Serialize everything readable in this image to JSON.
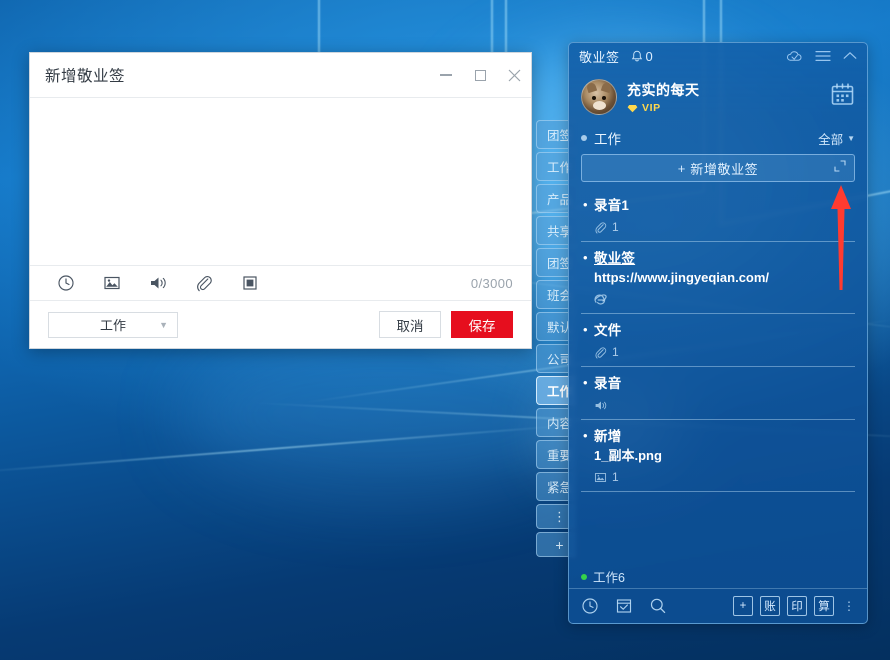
{
  "desktop": {
    "wallpaper_name": "windows-10-hero-wallpaper"
  },
  "dialog": {
    "title": "新增敬业签",
    "window_buttons": {
      "minimize": "minimize-icon",
      "maximize": "maximize-icon",
      "close": "close-icon"
    },
    "editor_placeholder": "",
    "editor_value": "",
    "toolbar": {
      "icons": [
        {
          "name": "reminder-clock-icon",
          "label": "提醒"
        },
        {
          "name": "image-icon",
          "label": "图片"
        },
        {
          "name": "sound-record-icon",
          "label": "录音"
        },
        {
          "name": "attachment-paperclip-icon",
          "label": "附件"
        },
        {
          "name": "screenshot-icon",
          "label": "截图"
        }
      ],
      "char_count": "0/3000"
    },
    "footer": {
      "category_value": "工作",
      "cancel_label": "取消",
      "save_label": "保存"
    }
  },
  "tabstrip": {
    "items": [
      {
        "label": "团签",
        "active": false
      },
      {
        "label": "工作",
        "active": false
      },
      {
        "label": "产品",
        "active": false
      },
      {
        "label": "共享",
        "active": false
      },
      {
        "label": "团签",
        "active": false
      },
      {
        "label": "班会",
        "active": false
      },
      {
        "label": "默认",
        "active": false
      },
      {
        "label": "公司",
        "active": false
      },
      {
        "label": "工作",
        "active": true
      },
      {
        "label": "内容",
        "active": false
      },
      {
        "label": "重要",
        "active": false
      },
      {
        "label": "紧急",
        "active": false
      },
      {
        "label": "⋮",
        "active": false
      },
      {
        "label": "+",
        "active": false
      }
    ]
  },
  "jyq": {
    "header": {
      "brand": "敬业签",
      "bell_icon": "bell-icon",
      "notification_count": "0",
      "icons": [
        {
          "name": "cloud-sync-icon"
        },
        {
          "name": "hamburger-menu-icon"
        },
        {
          "name": "chevron-up-icon"
        }
      ]
    },
    "user": {
      "avatar": "cat-avatar",
      "name": "充实的每天",
      "vip_badge_icon": "diamond-icon",
      "vip_label": "VIP",
      "calendar_icon": "calendar-icon"
    },
    "category_bar": {
      "name": "工作",
      "filter_label": "全部",
      "filter_chevron": "chevron-down-icon"
    },
    "add_button": {
      "plus": "+",
      "label": "新增敬业签",
      "expand_icon": "expand-icon"
    },
    "notes": [
      {
        "title": "录音1",
        "sub": "",
        "link": false,
        "meta_icon": "attachment-paperclip-icon",
        "meta_count": "1"
      },
      {
        "title": "敬业签",
        "sub": "https://www.jingyeqian.com/",
        "link": true,
        "meta_icon": "ie-browser-icon",
        "meta_count": ""
      },
      {
        "title": "文件",
        "sub": "",
        "link": false,
        "meta_icon": "attachment-paperclip-icon",
        "meta_count": "1"
      },
      {
        "title": "录音",
        "sub": "",
        "link": false,
        "meta_icon": "sound-record-icon",
        "meta_count": ""
      },
      {
        "title": "新增",
        "sub": "1_副本.png",
        "link": false,
        "meta_icon": "image-icon",
        "meta_count": "1"
      }
    ],
    "status": {
      "dot_color": "#35d24a",
      "text": "工作6"
    },
    "footer": {
      "left_icons": [
        {
          "name": "clock-icon"
        },
        {
          "name": "checklist-icon"
        },
        {
          "name": "search-icon"
        }
      ],
      "right_buttons": [
        {
          "name": "add-button",
          "label": "+"
        },
        {
          "name": "ledger-button",
          "label": "账"
        },
        {
          "name": "print-button",
          "label": "印"
        },
        {
          "name": "calculator-button",
          "label": "算"
        }
      ],
      "more_icon": "more-vertical-icon"
    }
  },
  "annotation": {
    "arrow": {
      "name": "red-arrow-annotation",
      "color": "#ff3b30",
      "direction": "up"
    }
  }
}
